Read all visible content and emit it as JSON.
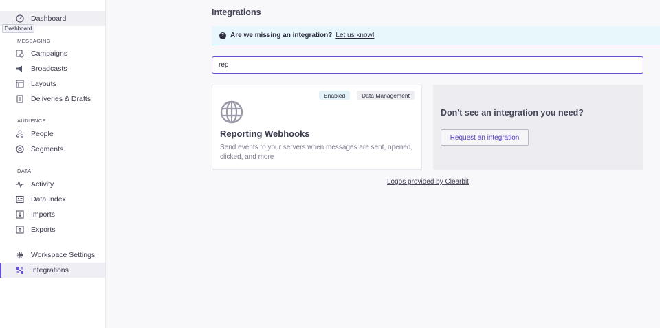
{
  "sidebar": {
    "tooltip": "Dashboard",
    "items": {
      "dashboard": "Dashboard",
      "campaigns": "Campaigns",
      "broadcasts": "Broadcasts",
      "layouts": "Layouts",
      "deliveries": "Deliveries & Drafts",
      "people": "People",
      "segments": "Segments",
      "activity": "Activity",
      "data_index": "Data Index",
      "imports": "Imports",
      "exports": "Exports",
      "workspace_settings": "Workspace Settings",
      "integrations": "Integrations"
    },
    "sections": {
      "messaging": "MESSAGING",
      "audience": "AUDIENCE",
      "data": "DATA"
    }
  },
  "main": {
    "title": "Integrations",
    "banner": {
      "icon": "question-circle-icon",
      "message": "Are we missing an integration?",
      "link": "Let us know!"
    },
    "search": {
      "value": "rep"
    },
    "card": {
      "badges": [
        "Enabled",
        "Data Management"
      ],
      "logo_icon": "globe-icon",
      "name": "Reporting Webhooks",
      "description": "Send events to your servers when messages are sent, opened, clicked, and more"
    },
    "cta": {
      "heading": "Don't see an integration you need?",
      "button": "Request an integration"
    },
    "footer_link": "Logos provided by Clearbit"
  },
  "colors": {
    "accent": "#6b4fd1",
    "banner_bg": "#e7f7fb",
    "page_bg": "#f8f8fa"
  }
}
